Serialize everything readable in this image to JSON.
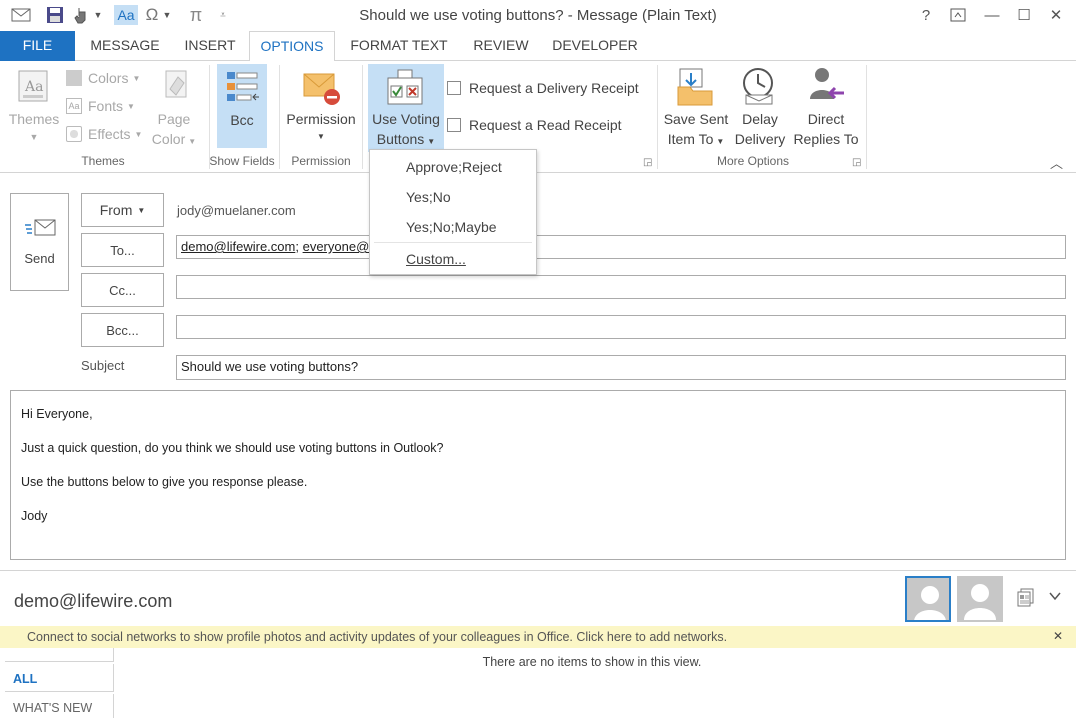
{
  "window": {
    "title": "Should we use voting buttons? - Message (Plain Text)",
    "help": "?",
    "minimize": "—",
    "maximize": "☐",
    "close": "✕"
  },
  "qat": {
    "aa": "Aa",
    "omega": "Ω",
    "pi": "π"
  },
  "tabs": [
    "FILE",
    "MESSAGE",
    "INSERT",
    "OPTIONS",
    "FORMAT TEXT",
    "REVIEW",
    "DEVELOPER"
  ],
  "ribbon": {
    "themes_group": {
      "themes_label": "Themes",
      "colors_label": "Colors",
      "fonts_label": "Fonts",
      "effects_label": "Effects",
      "page_color_line1": "Page",
      "page_color_line2": "Color",
      "group_label": "Themes"
    },
    "show_fields_group": {
      "bcc_label": "Bcc",
      "group_label": "Show Fields"
    },
    "permission_group": {
      "permission_label": "Permission",
      "group_label": "Permission"
    },
    "tracking_group": {
      "voting_line1": "Use Voting",
      "voting_line2": "Buttons",
      "delivery_receipt": "Request a Delivery Receipt",
      "read_receipt": "Request a Read Receipt"
    },
    "more_options_group": {
      "save_sent_line1": "Save Sent",
      "save_sent_line2": "Item To",
      "delay_line1": "Delay",
      "delay_line2": "Delivery",
      "direct_line1": "Direct",
      "direct_line2": "Replies To",
      "group_label": "More Options"
    },
    "collapse": "︿"
  },
  "voting_menu": {
    "items": [
      "Approve;Reject",
      "Yes;No",
      "Yes;No;Maybe"
    ],
    "custom": "Custom..."
  },
  "compose": {
    "send_label": "Send",
    "from_label": "From",
    "from_value": "jody@muelaner.com",
    "to_label": "To...",
    "to_value_1": "demo@lifewire.com",
    "to_sep": ";",
    "to_value_2": "everyone@",
    "cc_label": "Cc...",
    "bcc_label": "Bcc...",
    "subject_label": "Subject",
    "subject_value": "Should we use voting buttons?"
  },
  "body": {
    "lines": [
      "Hi Everyone,",
      "Just a quick question, do you think we should use voting buttons in Outlook?",
      "Use the buttons below to give you response please.",
      "Jody"
    ]
  },
  "people_pane": {
    "contact": "demo@lifewire.com",
    "info_message": "Connect to social networks to show profile photos and activity updates of your colleagues in Office. Click here to add networks.",
    "info_close": "✕",
    "empty_message": "There are no items to show in this view.",
    "tab_all": "ALL",
    "tab_whats_new": "WHAT'S NEW"
  },
  "colors": {
    "accent": "#1e72c2",
    "selected_button": "#c5dff5",
    "infobar": "#fbf6c6"
  }
}
